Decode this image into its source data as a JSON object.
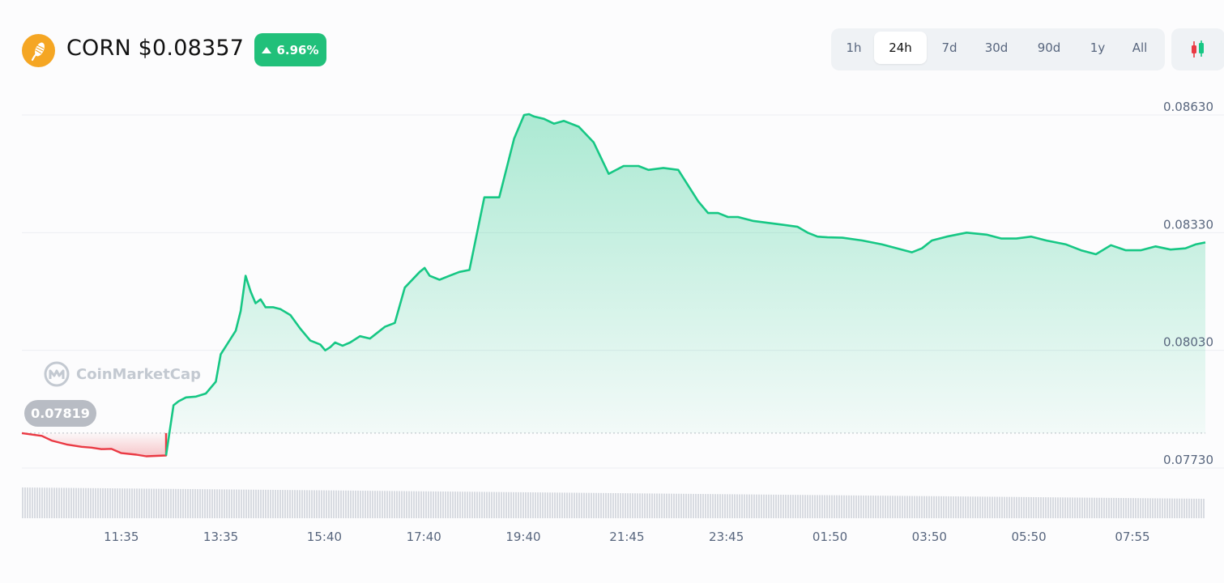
{
  "header": {
    "symbol": "CORN",
    "price": "$0.08357",
    "change": "6.96%",
    "change_direction": "up",
    "logo_icon": "corn-icon"
  },
  "timeframes": [
    {
      "label": "1h",
      "active": false
    },
    {
      "label": "24h",
      "active": true
    },
    {
      "label": "7d",
      "active": false
    },
    {
      "label": "30d",
      "active": false
    },
    {
      "label": "90d",
      "active": false
    },
    {
      "label": "1y",
      "active": false
    },
    {
      "label": "All",
      "active": false
    }
  ],
  "chart_toggle_icon": "candlestick-icon",
  "watermark": "CoinMarketCap",
  "reference_price": "0.07819",
  "colors": {
    "up": "#16c784",
    "down": "#ea3943",
    "badge": "#21c07a",
    "logo": "#f5a623"
  },
  "chart_data": {
    "type": "area",
    "title": "",
    "xlabel": "",
    "ylabel": "",
    "y_ticks": [
      "0.08630",
      "0.08330",
      "0.08030",
      "0.07730"
    ],
    "y_tick_values": [
      0.0863,
      0.0833,
      0.0803,
      0.0773
    ],
    "ylim": [
      0.077,
      0.0865
    ],
    "x_ticks": [
      "11:35",
      "13:35",
      "15:40",
      "17:40",
      "19:40",
      "21:45",
      "23:45",
      "01:50",
      "03:50",
      "05:50",
      "07:55"
    ],
    "x_tick_hours": [
      1.5,
      3.5,
      5.583,
      7.583,
      9.583,
      11.667,
      13.667,
      15.75,
      17.75,
      19.75,
      21.833
    ],
    "x_range_hours": [
      -0.5,
      23.3
    ],
    "baseline": 0.07819,
    "grid": true,
    "series": [
      {
        "hours": [
          -0.5,
          -0.1,
          0.1,
          0.4,
          0.7,
          0.9,
          1.1,
          1.3,
          1.5,
          1.8,
          2.0,
          2.2,
          2.4,
          2.55,
          2.65,
          2.8,
          3.0,
          3.2,
          3.4,
          3.5,
          3.6,
          3.8,
          3.9,
          4.0,
          4.1,
          4.2,
          4.3,
          4.4,
          4.55,
          4.7,
          4.9,
          5.1,
          5.3,
          5.5,
          5.6,
          5.7,
          5.8,
          5.95,
          6.1,
          6.3,
          6.5,
          6.6,
          6.8,
          7.0,
          7.2,
          7.5,
          7.6,
          7.7,
          7.9,
          8.1,
          8.3,
          8.5,
          8.8,
          9.1,
          9.4,
          9.6,
          9.7,
          9.8,
          10.0,
          10.2,
          10.4,
          10.7,
          11.0,
          11.3,
          11.6,
          11.9,
          12.1,
          12.4,
          12.7,
          12.9,
          13.1,
          13.3,
          13.5,
          13.7,
          13.9,
          14.2,
          14.5,
          14.8,
          15.1,
          15.3,
          15.5,
          15.7,
          16.0,
          16.4,
          16.8,
          17.1,
          17.4,
          17.6,
          17.8,
          18.1,
          18.5,
          18.9,
          19.2,
          19.5,
          19.8,
          20.1,
          20.5,
          20.8,
          21.1,
          21.4,
          21.7,
          22.0,
          22.3,
          22.6,
          22.9,
          23.1,
          23.3
        ],
        "values": [
          0.07819,
          0.07812,
          0.078,
          0.0779,
          0.07784,
          0.07782,
          0.07778,
          0.07779,
          0.07768,
          0.07764,
          0.0776,
          0.07761,
          0.07762,
          0.0789,
          0.079,
          0.0791,
          0.07912,
          0.0792,
          0.0795,
          0.0802,
          0.0804,
          0.0808,
          0.0813,
          0.0822,
          0.0818,
          0.0815,
          0.0816,
          0.0814,
          0.0814,
          0.08135,
          0.0812,
          0.08085,
          0.08055,
          0.08045,
          0.0803,
          0.08038,
          0.0805,
          0.08042,
          0.0805,
          0.08066,
          0.0806,
          0.0807,
          0.0809,
          0.081,
          0.0819,
          0.0823,
          0.0824,
          0.0822,
          0.0821,
          0.0822,
          0.0823,
          0.08235,
          0.0842,
          0.0842,
          0.0857,
          0.0863,
          0.08632,
          0.08626,
          0.0862,
          0.08608,
          0.08615,
          0.086,
          0.0856,
          0.0848,
          0.085,
          0.085,
          0.0849,
          0.08495,
          0.0849,
          0.0845,
          0.0841,
          0.0838,
          0.0838,
          0.0837,
          0.0837,
          0.0836,
          0.08355,
          0.0835,
          0.08345,
          0.0833,
          0.0832,
          0.08318,
          0.08317,
          0.0831,
          0.083,
          0.0829,
          0.0828,
          0.0829,
          0.0831,
          0.0832,
          0.0833,
          0.08325,
          0.08315,
          0.08315,
          0.0832,
          0.0831,
          0.083,
          0.08285,
          0.08275,
          0.08298,
          0.08285,
          0.08285,
          0.08295,
          0.08287,
          0.0829,
          0.083,
          0.08305
        ]
      }
    ],
    "volume": "decreasing-bars"
  }
}
